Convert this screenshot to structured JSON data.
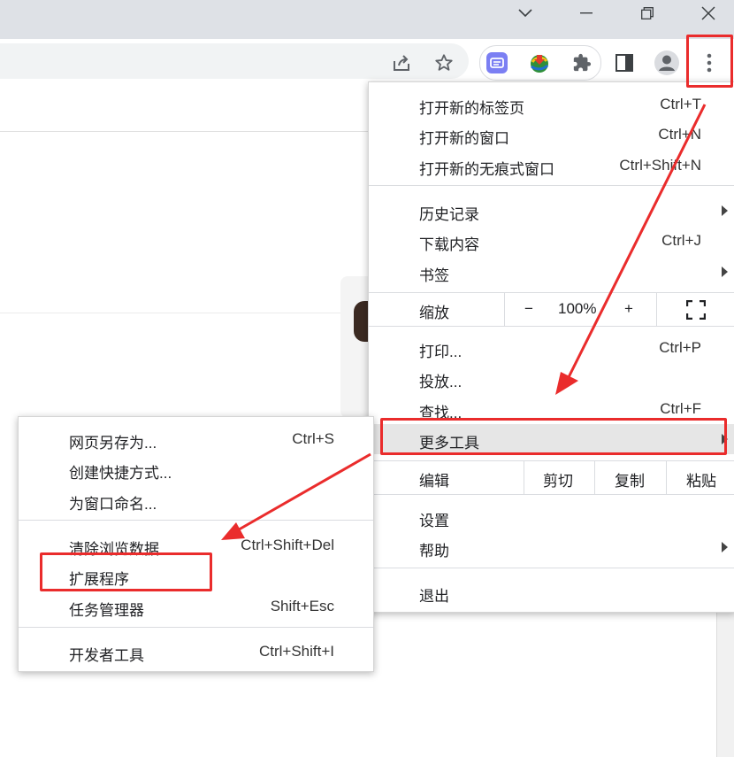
{
  "colors": {
    "titlebar_bg": "#dee1e6",
    "menu_hover": "#e6e6e6",
    "annotation_red": "#ea2c2c",
    "extension_purple": "#7b7ff3"
  },
  "window_controls": {
    "icons": [
      "chevron-down-icon",
      "minimize-icon",
      "restore-icon",
      "close-icon"
    ]
  },
  "toolbar": {
    "icons": [
      "share-icon",
      "star-icon",
      "google-translate-extension-icon",
      "idm-extension-icon",
      "puzzle-icon",
      "side-panel-icon",
      "profile-icon",
      "more-vert-icon"
    ]
  },
  "main_menu": {
    "new_tab": {
      "label": "打开新的标签页",
      "shortcut": "Ctrl+T"
    },
    "new_window": {
      "label": "打开新的窗口",
      "shortcut": "Ctrl+N"
    },
    "new_incognito": {
      "label": "打开新的无痕式窗口",
      "shortcut": "Ctrl+Shift+N"
    },
    "history": {
      "label": "历史记录"
    },
    "downloads": {
      "label": "下载内容",
      "shortcut": "Ctrl+J"
    },
    "bookmarks": {
      "label": "书签"
    },
    "zoom": {
      "label": "缩放",
      "minus": "−",
      "value": "100%",
      "plus": "+"
    },
    "print": {
      "label": "打印...",
      "shortcut": "Ctrl+P"
    },
    "cast": {
      "label": "投放..."
    },
    "find": {
      "label": "查找...",
      "shortcut": "Ctrl+F"
    },
    "more_tools": {
      "label": "更多工具"
    },
    "edit": {
      "label": "编辑",
      "cut": "剪切",
      "copy": "复制",
      "paste": "粘贴"
    },
    "settings": {
      "label": "设置"
    },
    "help": {
      "label": "帮助"
    },
    "exit": {
      "label": "退出"
    }
  },
  "sub_menu": {
    "save_page": {
      "label": "网页另存为...",
      "shortcut": "Ctrl+S"
    },
    "create_shortcut": {
      "label": "创建快捷方式..."
    },
    "name_window": {
      "label": "为窗口命名..."
    },
    "clear_data": {
      "label": "清除浏览数据...",
      "shortcut": "Ctrl+Shift+Del"
    },
    "extensions": {
      "label": "扩展程序"
    },
    "task_manager": {
      "label": "任务管理器",
      "shortcut": "Shift+Esc"
    },
    "dev_tools": {
      "label": "开发者工具",
      "shortcut": "Ctrl+Shift+I"
    }
  }
}
